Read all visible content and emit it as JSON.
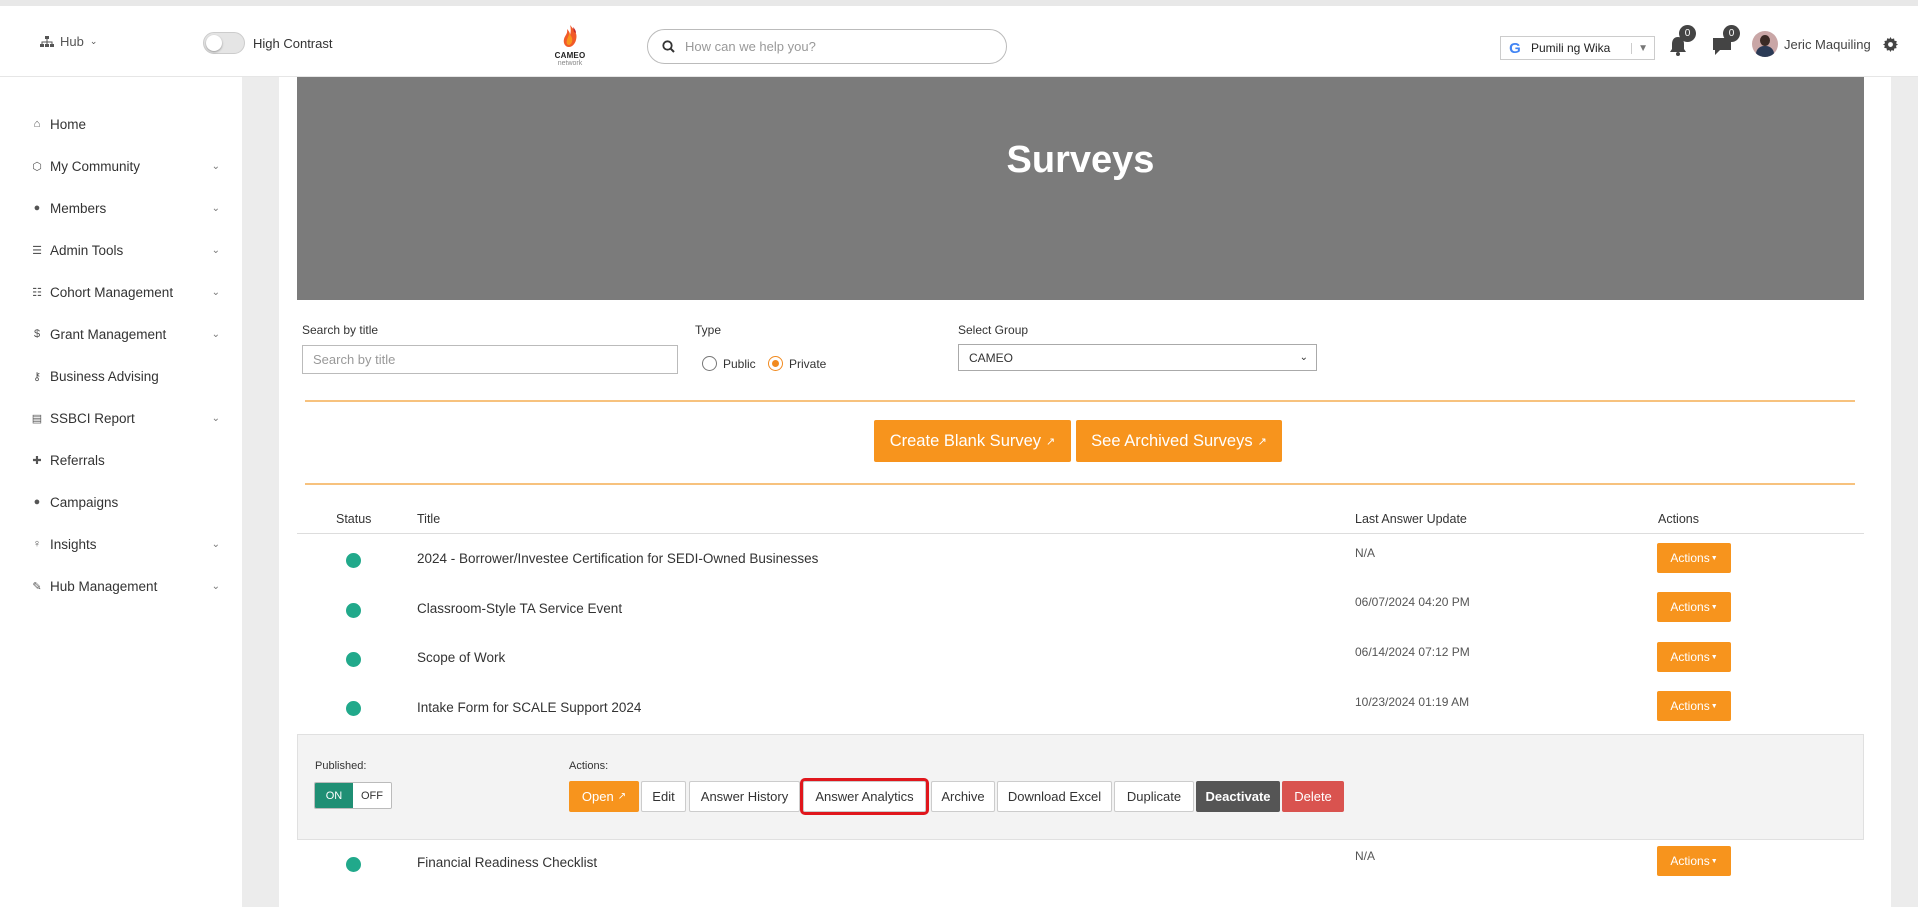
{
  "topbar": {
    "hub_label": "Hub",
    "high_contrast_label": "High Contrast",
    "logo_text": "CAMEO",
    "logo_sub": "network",
    "search_placeholder": "How can we help you?",
    "translate_label": "Pumili ng Wika",
    "notifications_count": "0",
    "messages_count": "0",
    "user_name": "Jeric Maquiling"
  },
  "sidebar": {
    "items": [
      {
        "label": "Home",
        "icon": "home-icon",
        "expandable": false
      },
      {
        "label": "My Community",
        "icon": "community-icon",
        "expandable": true
      },
      {
        "label": "Members",
        "icon": "user-circle-icon",
        "expandable": true
      },
      {
        "label": "Admin Tools",
        "icon": "tools-icon",
        "expandable": true
      },
      {
        "label": "Cohort Management",
        "icon": "list-icon",
        "expandable": true
      },
      {
        "label": "Grant Management",
        "icon": "dollar-icon",
        "expandable": true
      },
      {
        "label": "Business Advising",
        "icon": "key-icon",
        "expandable": false
      },
      {
        "label": "SSBCI Report",
        "icon": "file-icon",
        "expandable": true
      },
      {
        "label": "Referrals",
        "icon": "user-plus-icon",
        "expandable": false
      },
      {
        "label": "Campaigns",
        "icon": "comment-icon",
        "expandable": false
      },
      {
        "label": "Insights",
        "icon": "lightbulb-icon",
        "expandable": true
      },
      {
        "label": "Hub Management",
        "icon": "wrench-icon",
        "expandable": true
      }
    ]
  },
  "page": {
    "title": "Surveys",
    "filters": {
      "search_label": "Search by title",
      "search_placeholder": "Search by title",
      "type_label": "Type",
      "type_public": "Public",
      "type_private": "Private",
      "type_selected": "Private",
      "group_label": "Select Group",
      "group_value": "CAMEO"
    },
    "buttons": {
      "create_blank": "Create Blank Survey",
      "see_archived": "See Archived Surveys"
    },
    "table": {
      "headers": {
        "status": "Status",
        "title": "Title",
        "last_update": "Last Answer Update",
        "actions": "Actions"
      },
      "action_label": "Actions",
      "rows": [
        {
          "title": "2024 - Borrower/Investee Certification for SEDI-Owned Businesses",
          "last_update": "N/A",
          "status_color": "#21a98b"
        },
        {
          "title": "Classroom-Style TA Service Event",
          "last_update": "06/07/2024 04:20 PM",
          "status_color": "#21a98b"
        },
        {
          "title": "Scope of Work",
          "last_update": "06/14/2024 07:12 PM",
          "status_color": "#21a98b"
        },
        {
          "title": "Intake Form for SCALE Support 2024",
          "last_update": "10/23/2024 01:19 AM",
          "status_color": "#21a98b"
        },
        {
          "title": "Financial Readiness Checklist",
          "last_update": "N/A",
          "status_color": "#21a98b"
        }
      ]
    },
    "expanded_row": {
      "published_label": "Published:",
      "on_label": "ON",
      "off_label": "OFF",
      "actions_label": "Actions:",
      "buttons": {
        "open": "Open",
        "edit": "Edit",
        "answer_history": "Answer History",
        "answer_analytics": "Answer Analytics",
        "archive": "Archive",
        "download_excel": "Download Excel",
        "duplicate": "Duplicate",
        "deactivate": "Deactivate",
        "delete": "Delete"
      }
    }
  },
  "colors": {
    "accent_orange": "#f7941d",
    "status_green": "#21a98b",
    "published_on": "#1f8f74",
    "delete_red": "#d9534f",
    "highlight_red": "#e0161c",
    "hero_gray": "#7b7b7b"
  }
}
